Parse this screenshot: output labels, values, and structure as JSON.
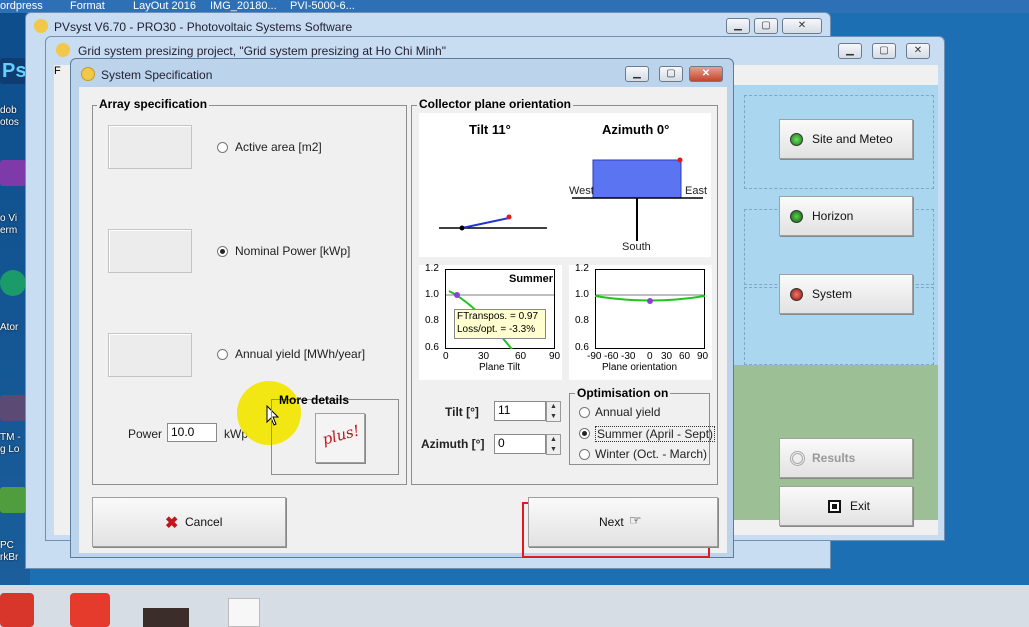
{
  "desktop": {
    "top_items": [
      "ordpress",
      "Format",
      "LayOut 2016",
      "IMG_20180...",
      "PVI-5000-6..."
    ],
    "left_labels": [
      "Ps",
      "dob",
      "otos",
      "o Vi",
      "erm",
      "Ator",
      "TM -",
      "g Lo",
      "PC",
      "rkBr"
    ]
  },
  "windows": {
    "pvsyst_title": "PVsyst V6.70 - PRO30 - Photovoltaic Systems Software",
    "project_title": "Grid system presizing project, \"Grid system presizing  at  Ho Chi Minh\"",
    "project_menu_stub": "F"
  },
  "dialog": {
    "title": "System Specification",
    "array": {
      "title": "Array specification",
      "options": [
        "Active area [m2]",
        "Nominal Power [kWp]",
        "Annual yield [MWh/year]"
      ],
      "selected_index": 1,
      "power_label": "Power",
      "power_value": "10.0",
      "power_unit": "kWp",
      "more_details": "More details",
      "plus_label": "plus!"
    },
    "orientation": {
      "title": "Collector plane orientation",
      "tilt_heading": "Tilt 11°",
      "azimuth_heading": "Azimuth 0°",
      "west": "West",
      "east": "East",
      "south": "South",
      "chart1_label": "Summer",
      "chart1_box1": "FTranspos. = 0.97",
      "chart1_box2": "Loss/opt. = -3.3%",
      "chart1_xlabel": "Plane Tilt",
      "chart1_xticks": [
        "0",
        "30",
        "60",
        "90"
      ],
      "chart_yticks": [
        "1.2",
        "1.0",
        "0.8",
        "0.6"
      ],
      "chart2_xlabel": "Plane orientation",
      "chart2_xticks": [
        "-90",
        "-60",
        "-30",
        "0",
        "30",
        "60",
        "90"
      ],
      "tilt_label": "Tilt [°]",
      "tilt_value": "11",
      "azimuth_label": "Azimuth [°]",
      "azimuth_value": "0",
      "opt_title": "Optimisation on",
      "opt_options": [
        "Annual yield",
        "Summer (April - Sept)",
        "Winter (Oct. - March)"
      ],
      "opt_selected": 1
    },
    "cancel": "Cancel",
    "next": "Next"
  },
  "sidebar_buttons": {
    "site": "Site and Meteo",
    "horizon": "Horizon",
    "system": "System",
    "results": "Results",
    "exit": "Exit"
  },
  "colors": {
    "highlight_red": "#e0191f",
    "cursor_yellow": "#f3e600",
    "curve_green": "#22c21f",
    "opt_point": "#8a3fd6",
    "azimuth_blue": "#5b74f2"
  }
}
